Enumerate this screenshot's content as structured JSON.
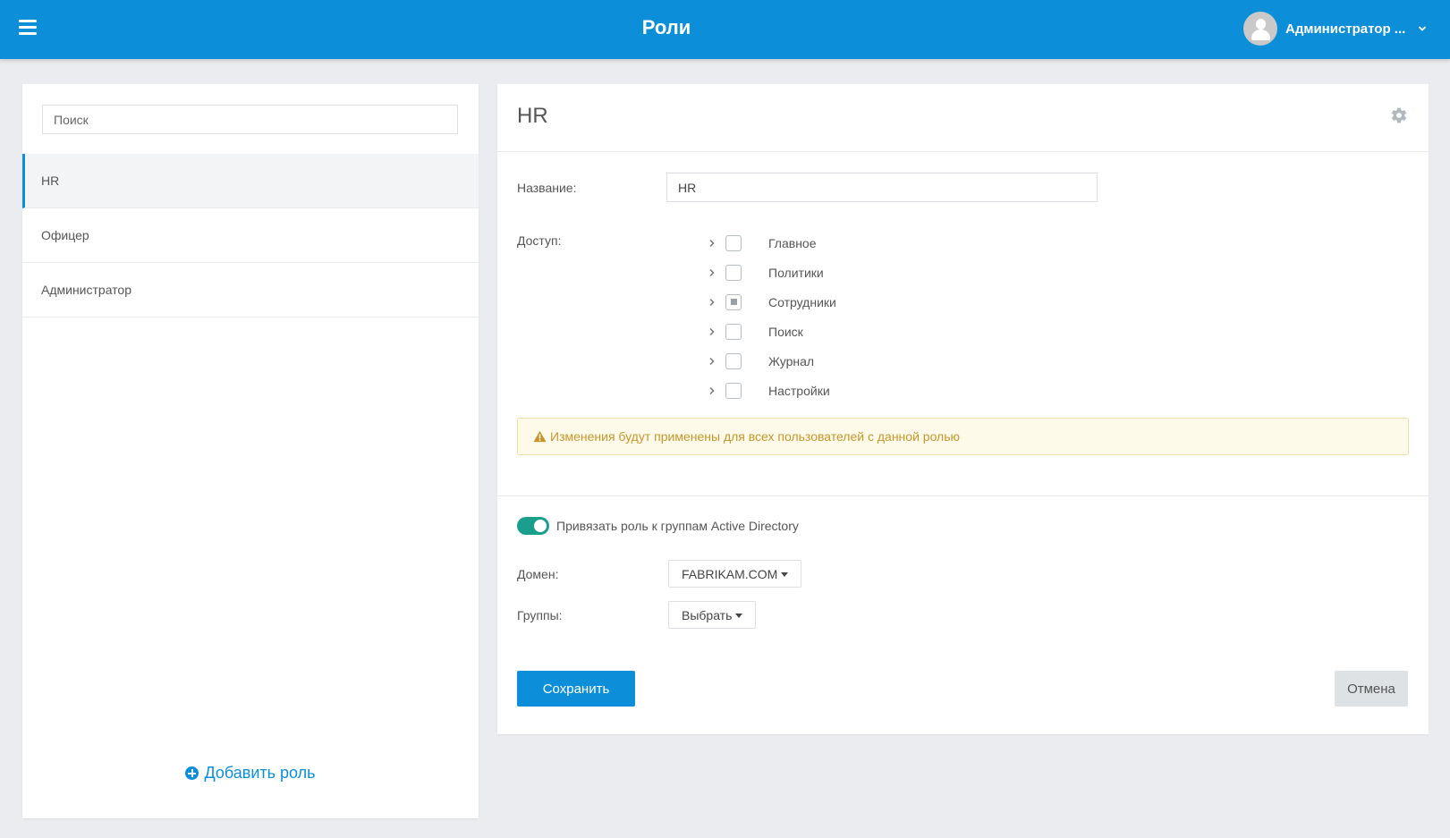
{
  "header": {
    "title": "Роли",
    "user_name": "Администратор ..."
  },
  "sidebar": {
    "search_placeholder": "Поиск",
    "roles": [
      {
        "label": "HR",
        "active": true
      },
      {
        "label": "Офицер",
        "active": false
      },
      {
        "label": "Администратор",
        "active": false
      }
    ],
    "add_role_label": "Добавить роль"
  },
  "editor": {
    "title": "HR",
    "name_label": "Название:",
    "name_value": "HR",
    "access_label": "Доступ:",
    "access_items": [
      {
        "label": "Главное",
        "state": "unchecked"
      },
      {
        "label": "Политики",
        "state": "unchecked"
      },
      {
        "label": "Сотрудники",
        "state": "partial"
      },
      {
        "label": "Поиск",
        "state": "unchecked"
      },
      {
        "label": "Журнал",
        "state": "unchecked"
      },
      {
        "label": "Настройки",
        "state": "unchecked"
      }
    ],
    "warning_text": "Изменения будут применены для всех пользователей с данной ролью",
    "ad_toggle_label": "Привязать роль к группам Active Directory",
    "ad_toggle_on": true,
    "domain_label": "Домен:",
    "domain_value": "FABRIKAM.COM",
    "groups_label": "Группы:",
    "groups_value": "Выбрать",
    "save_label": "Сохранить",
    "cancel_label": "Отмена"
  },
  "colors": {
    "primary": "#0d8ed8",
    "toggle_on": "#1a9f8c",
    "warning_bg": "#fdfaea",
    "warning_text": "#c7962b",
    "background": "#eaecf0"
  }
}
